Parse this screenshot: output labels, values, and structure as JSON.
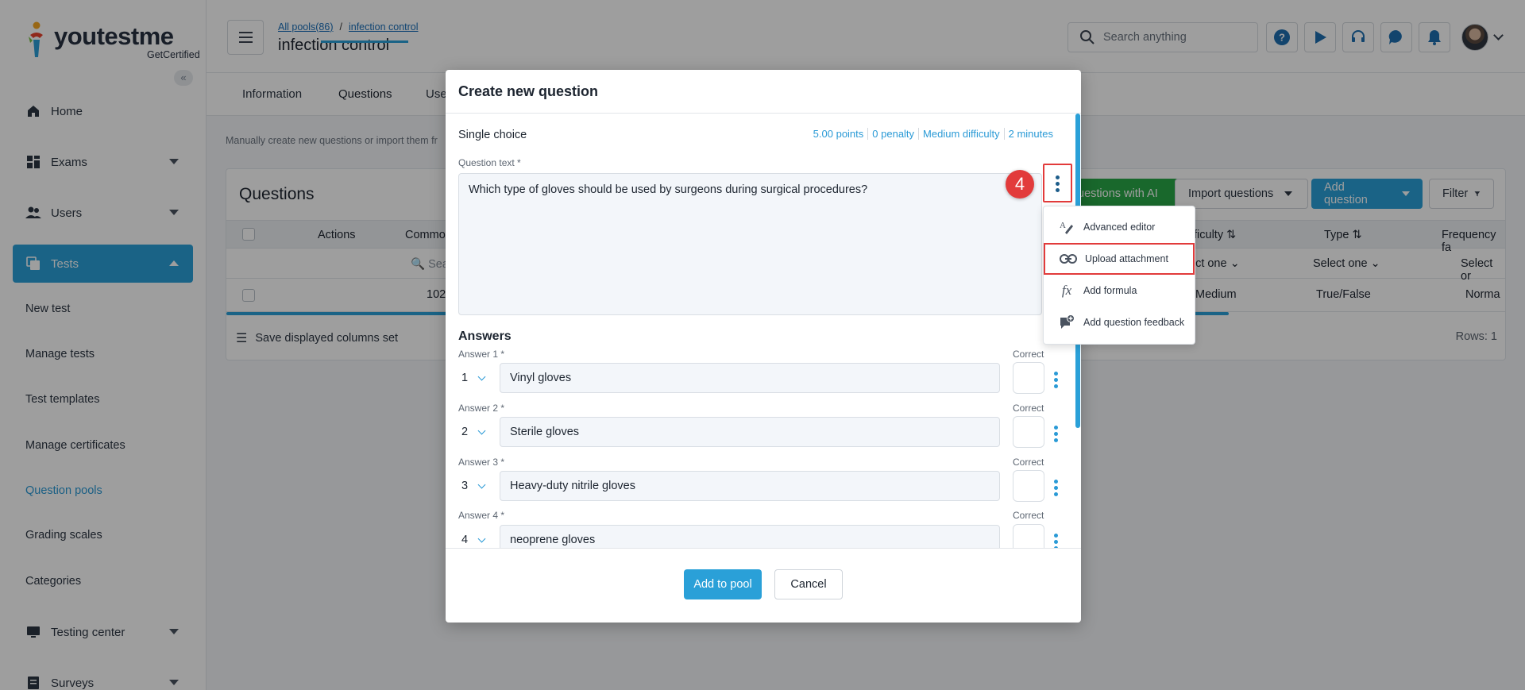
{
  "brand": {
    "name": "youtestme",
    "sub": "GetCertified"
  },
  "sidebar": {
    "items": [
      {
        "label": "Home",
        "icon": "home-icon"
      },
      {
        "label": "Exams",
        "icon": "exams-icon"
      },
      {
        "label": "Users",
        "icon": "users-icon"
      },
      {
        "label": "Tests",
        "icon": "tests-icon"
      }
    ],
    "sub_items": [
      "New test",
      "Manage tests",
      "Test templates",
      "Manage certificates",
      "Question pools",
      "Grading scales",
      "Categories"
    ],
    "bottom_items": [
      {
        "label": "Testing center",
        "icon": "monitor-icon"
      },
      {
        "label": "Surveys",
        "icon": "survey-icon"
      }
    ]
  },
  "header": {
    "breadcrumb": [
      "All pools(86)",
      "infection control"
    ],
    "breadcrumb_sep": "/",
    "title": "infection control",
    "search_placeholder": "Search anything"
  },
  "tabs": [
    "Information",
    "Questions",
    "Use"
  ],
  "hint": "Manually create new questions or import them fr",
  "questions": {
    "title": "Questions",
    "ai_button": "uestions with AI",
    "import_button": "Import questions",
    "add_button": "Add question",
    "filter_button": "Filter",
    "columns": {
      "actions": "Actions",
      "common": "Commo",
      "difficulty": "ficulty",
      "type": "Type",
      "frequency": "Frequency fa"
    },
    "filters": {
      "search": "Sea",
      "difficulty": "ect one",
      "type": "Select one",
      "frequency": "Select or"
    },
    "row": {
      "id": "102",
      "difficulty": "Medium",
      "type": "True/False",
      "frequency": "Norma"
    },
    "save_columns": "Save displayed columns set",
    "rows_label": "Rows: 1"
  },
  "modal": {
    "title": "Create new question",
    "question_type": "Single choice",
    "meta": [
      "5.00 points",
      "0 penalty",
      "Medium difficulty",
      "2 minutes"
    ],
    "question_text_label": "Question text *",
    "question_text": "Which type of gloves should be used by surgeons during surgical procedures?",
    "answers_title": "Answers",
    "correct_label": "Correct",
    "answers": [
      {
        "label": "Answer 1 *",
        "num": "1",
        "text": "Vinyl gloves"
      },
      {
        "label": "Answer 2 *",
        "num": "2",
        "text": "Sterile gloves"
      },
      {
        "label": "Answer 3 *",
        "num": "3",
        "text": "Heavy-duty nitrile gloves"
      },
      {
        "label": "Answer 4 *",
        "num": "4",
        "text": "neoprene gloves"
      }
    ],
    "add_button": "Add to pool",
    "cancel_button": "Cancel"
  },
  "step_badge": "4",
  "menu": [
    {
      "label": "Advanced editor",
      "icon": "text-edit-icon"
    },
    {
      "label": "Upload attachment",
      "icon": "link-icon"
    },
    {
      "label": "Add formula",
      "icon": "formula-icon",
      "glyph": "fx"
    },
    {
      "label": "Add question feedback",
      "icon": "feedback-icon"
    }
  ],
  "colors": {
    "accent": "#2aa0d8",
    "highlight": "#e23b3b",
    "green": "#29a847"
  }
}
